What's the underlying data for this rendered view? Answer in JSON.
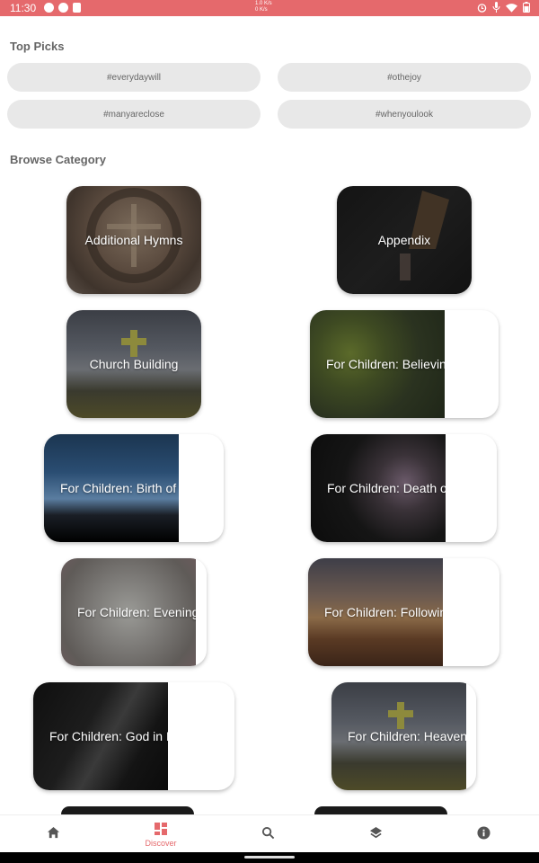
{
  "status_bar": {
    "time": "11:30",
    "center_top": "1.0 K/s",
    "center_bottom": "0 K/s"
  },
  "top_picks": {
    "title": "Top Picks",
    "chips": [
      "#everydaywill",
      "#othejoy",
      "#manyareclose",
      "#whenyoulook"
    ]
  },
  "browse": {
    "title": "Browse Category",
    "cards": [
      {
        "label": "Additional Hymns"
      },
      {
        "label": "Appendix"
      },
      {
        "label": "Church Building"
      },
      {
        "label": "For Children: Believing"
      },
      {
        "label": "For Children: Birth of C"
      },
      {
        "label": "For Children: Death of"
      },
      {
        "label": "For Children: Evening"
      },
      {
        "label": "For Children: Following"
      },
      {
        "label": "For Children: God in Pr"
      },
      {
        "label": "For Children: Heaven"
      }
    ]
  },
  "nav": {
    "items": [
      {
        "label": "",
        "icon": "home-icon"
      },
      {
        "label": "Discover",
        "icon": "discover-icon",
        "active": true
      },
      {
        "label": "",
        "icon": "search-icon"
      },
      {
        "label": "",
        "icon": "layers-icon"
      },
      {
        "label": "",
        "icon": "info-icon"
      }
    ],
    "accent": "#e5696c"
  }
}
